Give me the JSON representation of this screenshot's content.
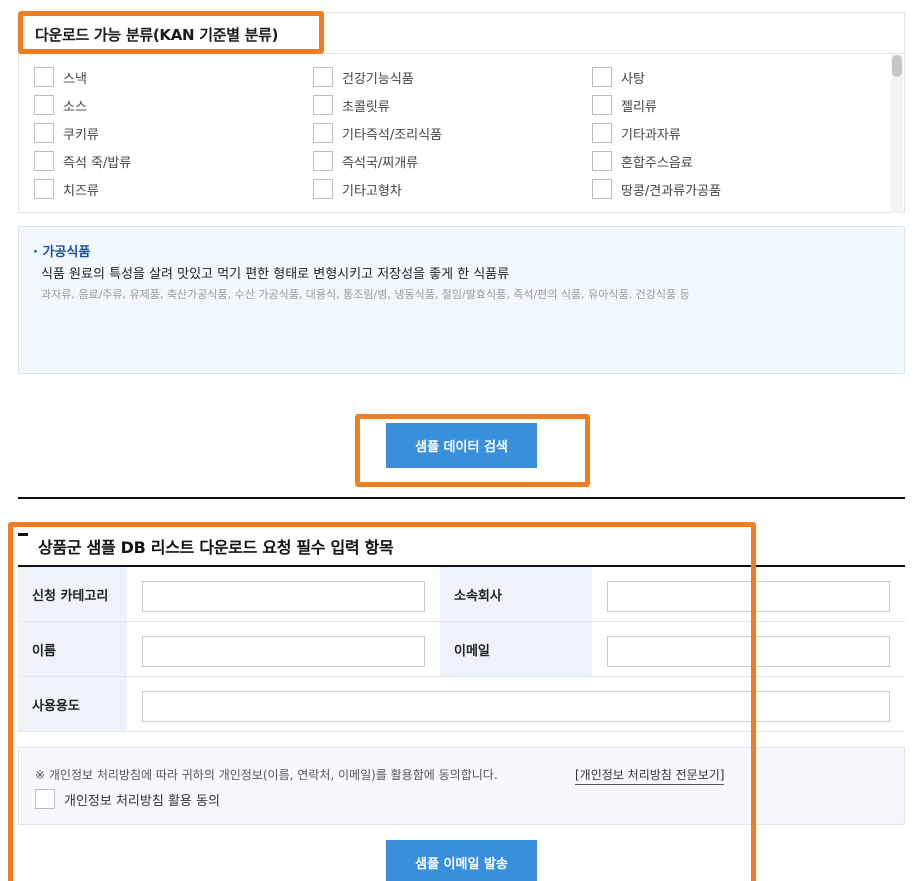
{
  "classification": {
    "title": "다운로드 가능 분류(KAN 기준별 분류)",
    "items": [
      {
        "label": "스낵",
        "checked": false
      },
      {
        "label": "건강기능식품",
        "checked": false
      },
      {
        "label": "사탕",
        "checked": false
      },
      {
        "label": "소스",
        "checked": false
      },
      {
        "label": "초콜릿류",
        "checked": false
      },
      {
        "label": "젤리류",
        "checked": false
      },
      {
        "label": "쿠키류",
        "checked": false
      },
      {
        "label": "기타즉석/조리식품",
        "checked": false
      },
      {
        "label": "기타과자류",
        "checked": false
      },
      {
        "label": "즉석 죽/밥류",
        "checked": false
      },
      {
        "label": "즉석국/찌개류",
        "checked": false
      },
      {
        "label": "혼합주스음료",
        "checked": false
      },
      {
        "label": "치즈류",
        "checked": false
      },
      {
        "label": "기타고형차",
        "checked": false
      },
      {
        "label": "땅콩/견과류가공품",
        "checked": false
      }
    ]
  },
  "info": {
    "title": "· 가공식품",
    "description": "식품 원료의 특성을 살려 맛있고 먹기 편한 형태로 변형시키고 저장성을 좋게 한 식품류",
    "examples": "과자류, 음료/주류, 유제품, 축산가공식품, 수산 가공식품, 대용식, 통조림/병, 냉동식품, 절임/발효식품, 즉석/편의 식품, 유아식품, 건강식품 등"
  },
  "search_button": "샘플 데이터 검색",
  "form": {
    "title": "상품군 샘플 DB 리스트 다운로드 요청 필수 입력 항목",
    "labels": {
      "category": "신청 카테고리",
      "company": "소속회사",
      "name": "이름",
      "email": "이메일",
      "purpose": "사용용도"
    },
    "values": {
      "category": "",
      "company": "",
      "name": "",
      "email": "",
      "purpose": ""
    }
  },
  "consent": {
    "text": "※ 개인정보 처리방침에 따라 귀하의 개인정보(이름, 연락처, 이메일)를 활용함에 동의합니다.",
    "link": "[개인정보 처리방침 전문보기]",
    "checkbox_label": "개인정보 처리방침 활용 동의",
    "checked": false
  },
  "email_button": "샘플 이메일 발송",
  "colors": {
    "accent_blue": "#3a8fdc",
    "highlight_orange": "#ef7d22",
    "info_title_blue": "#1f4f9a"
  }
}
